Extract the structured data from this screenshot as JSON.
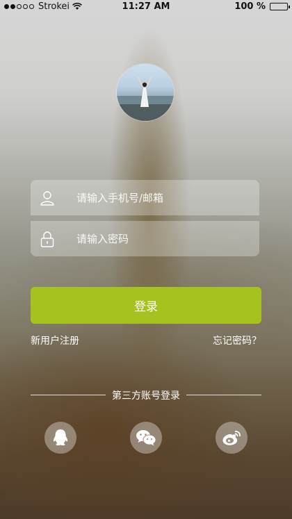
{
  "status_bar": {
    "carrier": "Strokei",
    "time": "11:27 AM",
    "battery": "100 %",
    "signal_bars_filled": 2,
    "signal_bars_total": 5,
    "battery_level": 1.0
  },
  "profile": {
    "avatar_icon": "user-avatar-photo"
  },
  "form": {
    "account_placeholder": "请输入手机号/邮箱",
    "account_icon": "user-icon",
    "password_placeholder": "请输入密码",
    "password_icon": "lock-icon"
  },
  "actions": {
    "login_label": "登录",
    "login_color": "#a6c21e",
    "register_label": "新用户注册",
    "forgot_label": "忘记密码？"
  },
  "third_party": {
    "heading": "第三方账号登录",
    "providers": [
      {
        "icon": "qq-icon"
      },
      {
        "icon": "wechat-icon"
      },
      {
        "icon": "weibo-icon"
      }
    ]
  }
}
